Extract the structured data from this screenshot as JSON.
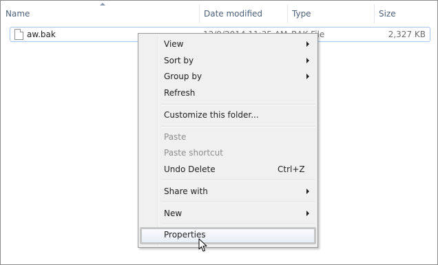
{
  "columns": {
    "name": "Name",
    "date_modified": "Date modified",
    "type": "Type",
    "size": "Size"
  },
  "file": {
    "name": "aw.bak",
    "date_modified": "12/9/2014 11:35 AM",
    "type": "BAK File",
    "size": "2,327 KB",
    "icon": "document-icon"
  },
  "context_menu": {
    "view": "View",
    "sort_by": "Sort by",
    "group_by": "Group by",
    "refresh": "Refresh",
    "customize": "Customize this folder...",
    "paste": "Paste",
    "paste_shortcut": "Paste shortcut",
    "undo_delete": "Undo Delete",
    "undo_delete_shortcut": "Ctrl+Z",
    "share_with": "Share with",
    "new": "New",
    "properties": "Properties"
  },
  "colors": {
    "header_text": "#4c607a",
    "selection_border": "#a9c7ea",
    "menu_bg": "#f0f0f0",
    "disabled_text": "#8d8d8d"
  }
}
